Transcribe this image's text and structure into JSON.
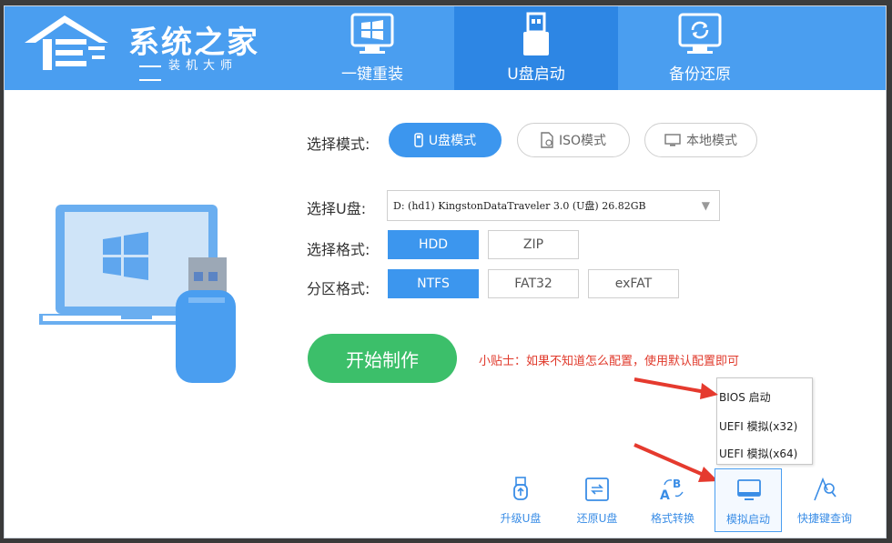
{
  "app": {
    "title": "系统之家",
    "subtitle": "装机大师"
  },
  "nav": {
    "tabs": [
      {
        "label": "一键重装",
        "icon": "windows-monitor-icon"
      },
      {
        "label": "U盘启动",
        "icon": "usb-drive-icon"
      },
      {
        "label": "备份还原",
        "icon": "backup-restore-icon"
      }
    ],
    "active": "U盘启动"
  },
  "mode": {
    "label": "选择模式:",
    "options": [
      {
        "label": "U盘模式",
        "icon": "usb-icon"
      },
      {
        "label": "ISO模式",
        "icon": "iso-file-icon"
      },
      {
        "label": "本地模式",
        "icon": "monitor-icon"
      }
    ],
    "selected": "U盘模式"
  },
  "disk": {
    "label": "选择U盘:",
    "value": "D: (hd1) KingstonDataTraveler 3.0 (U盘) 26.82GB"
  },
  "format": {
    "label": "选择格式:",
    "options": [
      "HDD",
      "ZIP"
    ],
    "selected": "HDD"
  },
  "partition": {
    "label": "分区格式:",
    "options": [
      "NTFS",
      "FAT32",
      "exFAT"
    ],
    "selected": "NTFS"
  },
  "start_button": "开始制作",
  "tip": "小贴士：如果不知道怎么配置，使用默认配置即可",
  "simulate_menu": {
    "items": [
      "BIOS 启动",
      "UEFI 模拟(x32)",
      "UEFI 模拟(x64)"
    ]
  },
  "tools": [
    {
      "label": "升级U盘",
      "icon": "usb-upgrade-icon"
    },
    {
      "label": "还原U盘",
      "icon": "restore-usb-icon"
    },
    {
      "label": "格式转换",
      "icon": "format-convert-icon"
    },
    {
      "label": "模拟启动",
      "icon": "monitor-icon"
    },
    {
      "label": "快捷键查询",
      "icon": "search-icon"
    }
  ],
  "colors": {
    "header": "#4a9ef0",
    "header_active_tab": "#2d86e4",
    "accent_blue": "#3c96ee",
    "start_green": "#3cbf6a",
    "tip_red": "#e0392b",
    "arrow_red": "#e53a2e"
  }
}
